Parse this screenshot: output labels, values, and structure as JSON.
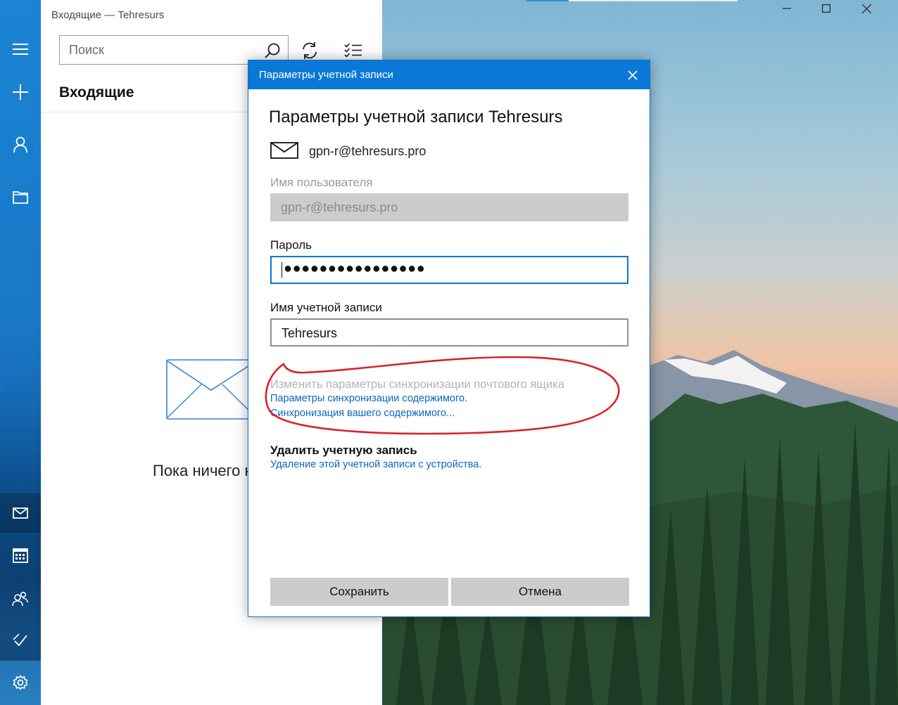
{
  "window": {
    "title": "Входящие — Tehresurs"
  },
  "rail": {
    "items": [
      "menu-icon",
      "new-mail-icon",
      "accounts-icon",
      "folders-icon"
    ],
    "bottom": [
      "mail-icon",
      "calendar-icon",
      "people-icon",
      "todo-icon",
      "settings-icon"
    ]
  },
  "pane": {
    "search_placeholder": "Поиск",
    "folder_title": "Входящие",
    "empty_text": "Пока ничего н"
  },
  "dialog": {
    "bar_title": "Параметры учетной записи",
    "heading": "Параметры учетной записи Tehresurs",
    "email": "gpn-r@tehresurs.pro",
    "username_label": "Имя пользователя",
    "username_value": "gpn-r@tehresurs.pro",
    "password_label": "Пароль",
    "password_mask": "●●●●●●●●●●●●●●●●",
    "account_name_label": "Имя учетной записи",
    "account_name_value": "Tehresurs",
    "sync_label": "Изменить параметры синхронизации почтового ящика",
    "sync_link_1": "Параметры синхронизации содержимого.",
    "sync_link_2": "Синхронизация вашего содержимого...",
    "delete_title": "Удалить учетную запись",
    "delete_link": "Удаление этой учетной записи с устройства.",
    "save_button": "Сохранить",
    "cancel_button": "Отмена"
  },
  "colors": {
    "accent": "#0a78d7",
    "link": "#0a66c2",
    "annotation": "#d8232a"
  }
}
